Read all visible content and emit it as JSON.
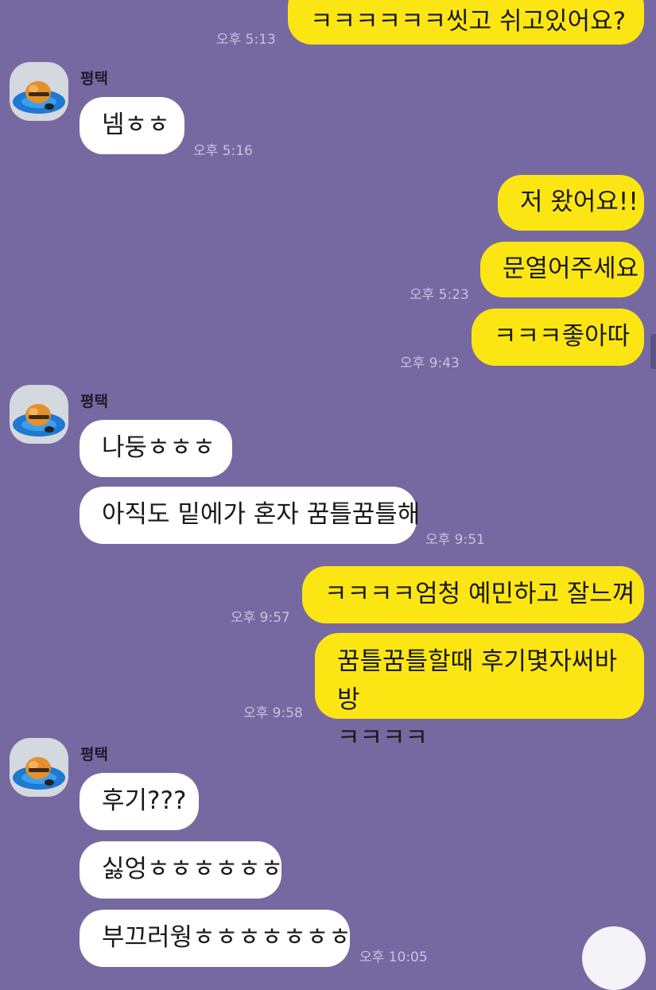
{
  "chat": {
    "messages": [
      {
        "text": "ㅋㅋㅋㅋㅋㅋ씻고 쉬고있어요?",
        "time": "오후 5:13"
      },
      {
        "sender": "평택",
        "text": "넴ㅎㅎ",
        "time": "오후 5:16"
      },
      {
        "text": "저 왔어요!!"
      },
      {
        "text": "문열어주세요",
        "time": "오후 5:23"
      },
      {
        "text": "ㅋㅋㅋ좋아따",
        "time": "오후 9:43"
      },
      {
        "sender": "평택",
        "text": "나둥ㅎㅎㅎ"
      },
      {
        "text": "아직도 밑에가 혼자 꿈틀꿈틀해",
        "time": "오후 9:51"
      },
      {
        "text": "ㅋㅋㅋㅋ엄청 예민하고 잘느껴",
        "time": "오후 9:57"
      },
      {
        "line1": "꿈틀꿈틀할때 후기몇자써바방",
        "line2": "ㅋㅋㅋㅋ",
        "time": "오후 9:58"
      },
      {
        "sender": "평택",
        "text": "후기???"
      },
      {
        "text": "싫엉ㅎㅎㅎㅎㅎㅎ"
      },
      {
        "text": "부끄러웡ㅎㅎㅎㅎㅎㅎㅎ",
        "time": "오후 10:05"
      }
    ]
  },
  "colors": {
    "background": "#7669a1",
    "my_bubble": "#fbe613",
    "their_bubble": "#ffffff",
    "timestamp": "#c9c1e0"
  },
  "icons": {
    "avatar": "avatar-character-on-float-icon"
  }
}
